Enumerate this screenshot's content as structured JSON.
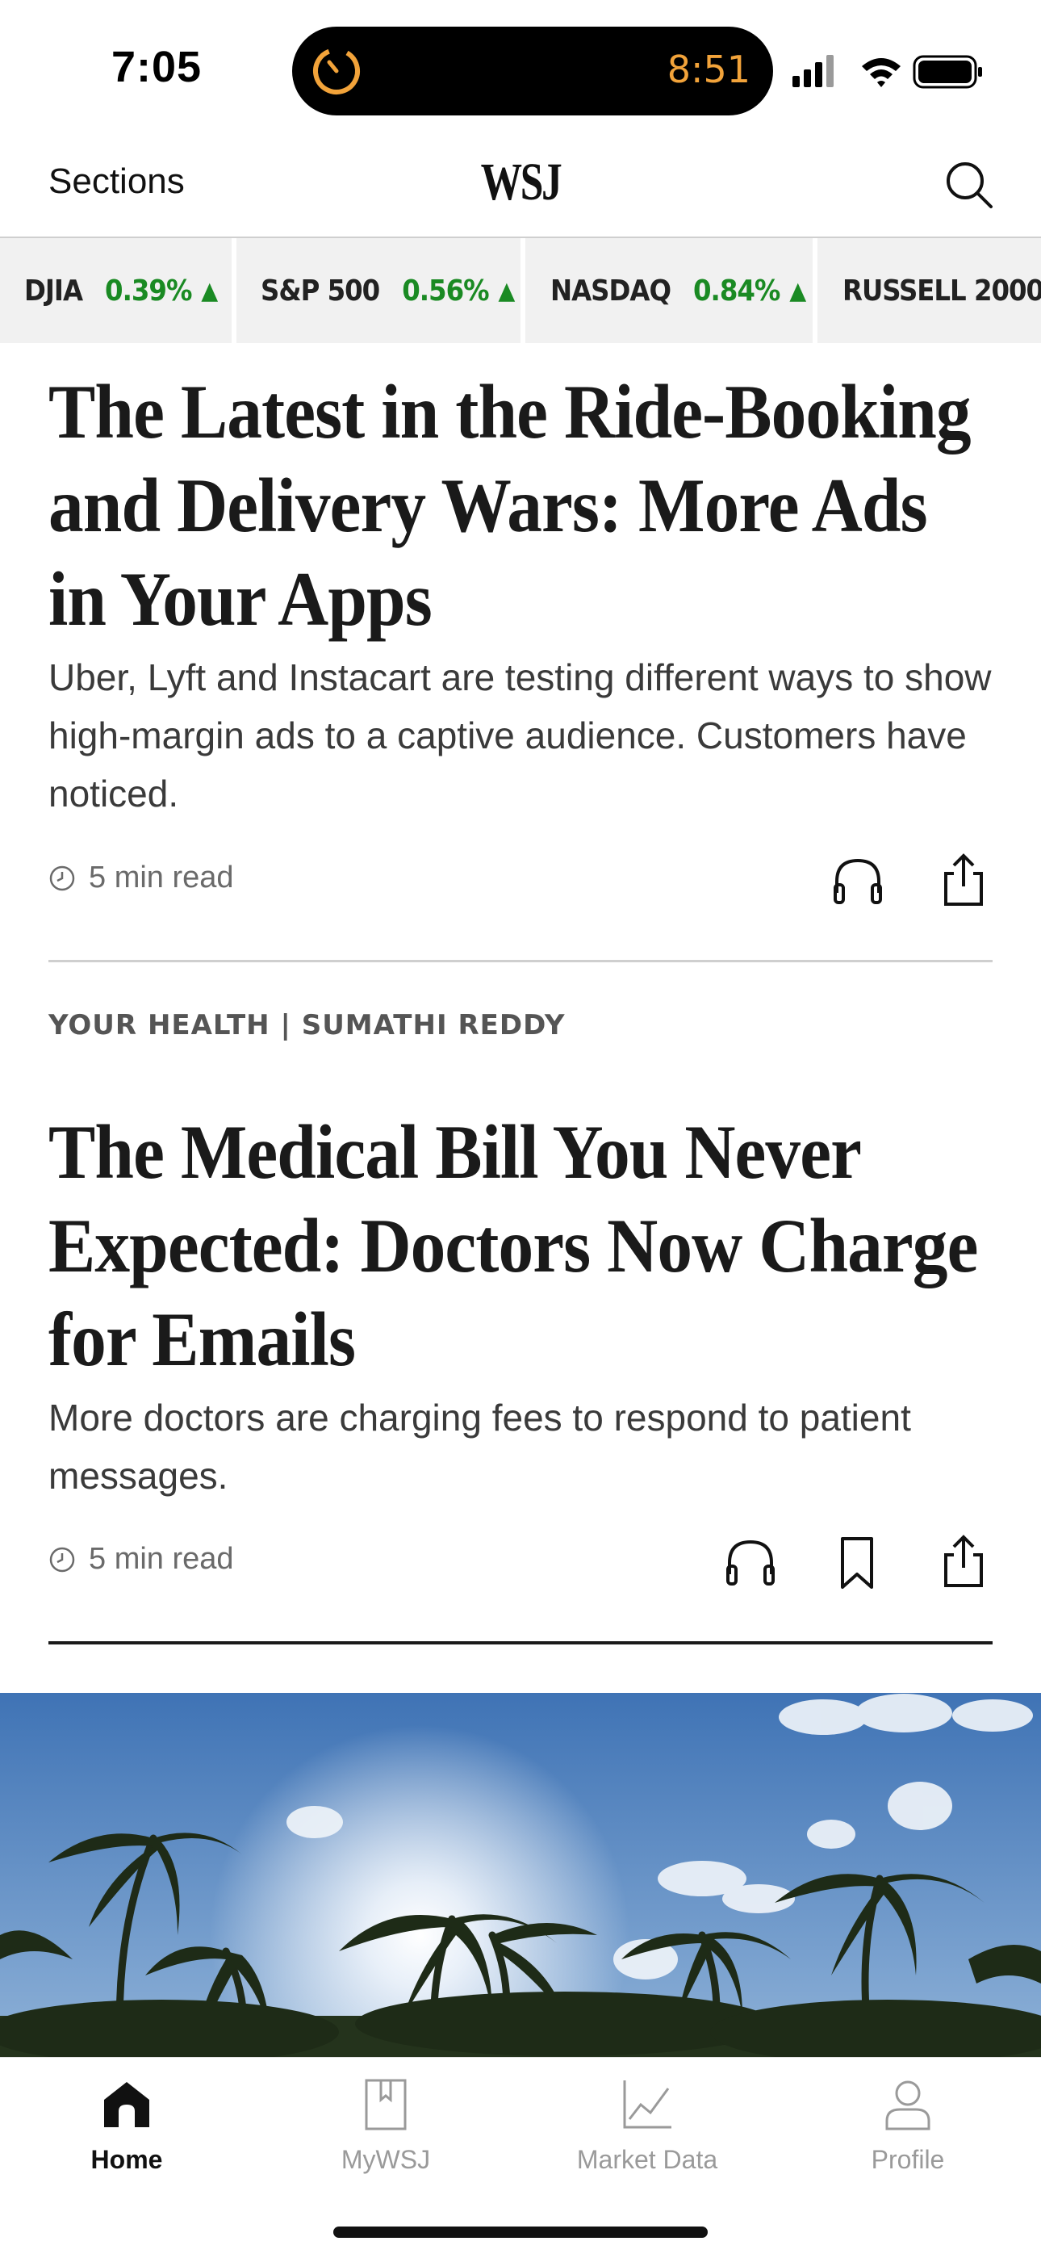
{
  "status_bar": {
    "time": "7:05",
    "timer_time": "8:51"
  },
  "header": {
    "sections_label": "Sections",
    "logo_text": "WSJ"
  },
  "ticker": [
    {
      "name": "DJIA",
      "change": "0.39%",
      "direction": "up"
    },
    {
      "name": "S&P 500",
      "change": "0.56%",
      "direction": "up"
    },
    {
      "name": "NASDAQ",
      "change": "0.84%",
      "direction": "up"
    },
    {
      "name": "RUSSELL 2000",
      "change": "",
      "direction": ""
    }
  ],
  "articles": [
    {
      "headline": "The Latest in the Ride-Booking and Delivery Wars: More Ads in Your Apps",
      "dek": "Uber, Lyft and Instacart are testing different ways to show high-margin ads to a captive audience. Customers have noticed.",
      "read_time": "5 min read"
    },
    {
      "kicker": "YOUR HEALTH | SUMATHI REDDY",
      "headline": "The Medical Bill You Never Expected: Doctors Now Charge for Emails",
      "dek": "More doctors are charging fees to respond to patient messages.",
      "read_time": "5 min read"
    }
  ],
  "photo": {
    "subject": "palm-trees-sky"
  },
  "tabbar": [
    {
      "label": "Home",
      "icon": "home-icon",
      "active": true
    },
    {
      "label": "MyWSJ",
      "icon": "bookmark-icon",
      "active": false
    },
    {
      "label": "Market Data",
      "icon": "chart-line-icon",
      "active": false
    },
    {
      "label": "Profile",
      "icon": "person-icon",
      "active": false
    }
  ],
  "colors": {
    "ticker_up": "#1a8a23",
    "timer_accent": "#f2a33a"
  }
}
